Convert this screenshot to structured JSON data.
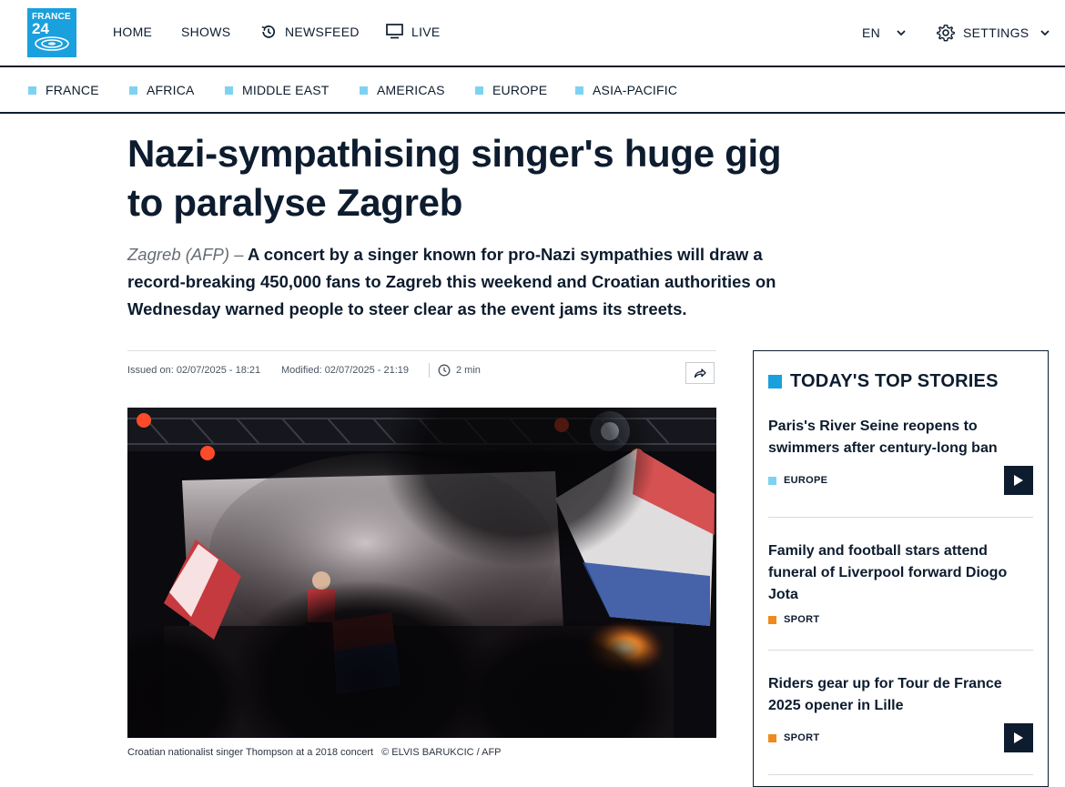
{
  "logo": {
    "line1": "FRANCE",
    "line2": "24"
  },
  "nav": {
    "home": "HOME",
    "shows": "SHOWS",
    "newsfeed": "NEWSFEED",
    "live": "LIVE",
    "language": "EN",
    "settings": "SETTINGS"
  },
  "regions": [
    {
      "label": "FRANCE"
    },
    {
      "label": "AFRICA"
    },
    {
      "label": "MIDDLE EAST"
    },
    {
      "label": "AMERICAS"
    },
    {
      "label": "EUROPE"
    },
    {
      "label": "ASIA-PACIFIC"
    }
  ],
  "article": {
    "title": "Nazi-sympathising singer's huge gig to paralyse Zagreb",
    "source": "Zagreb (AFP) –",
    "lede": "A concert by a singer known for pro-Nazi sympathies will draw a record-breaking 450,000 fans to Zagreb this weekend and Croatian authorities on Wednesday warned people to steer clear as the event jams its streets.",
    "issued": "Issued on: 02/07/2025 - 18:21",
    "modified": "Modified: 02/07/2025 - 21:19",
    "read_time": "2 min",
    "caption": "Croatian nationalist singer Thompson at a 2018 concert",
    "credit": "© ELVIS BARUKCIC / AFP"
  },
  "sidebar": {
    "title": "TODAY'S TOP STORIES",
    "stories": [
      {
        "title": "Paris's River Seine reopens to swimmers after century-long ban",
        "tag": "EUROPE",
        "tag_color": "#7ed2f1",
        "has_video": true
      },
      {
        "title": "Family and football stars attend funeral of Liverpool forward Diogo Jota",
        "tag": "SPORT",
        "tag_color": "#f08a1c",
        "has_video": false
      },
      {
        "title": "Riders gear up for Tour de France 2025 opener in Lille",
        "tag": "SPORT",
        "tag_color": "#f08a1c",
        "has_video": true
      }
    ]
  },
  "colors": {
    "brand": "#1aa0dd",
    "ink": "#0d1c2e",
    "europe": "#7ed2f1",
    "sport": "#f08a1c"
  }
}
